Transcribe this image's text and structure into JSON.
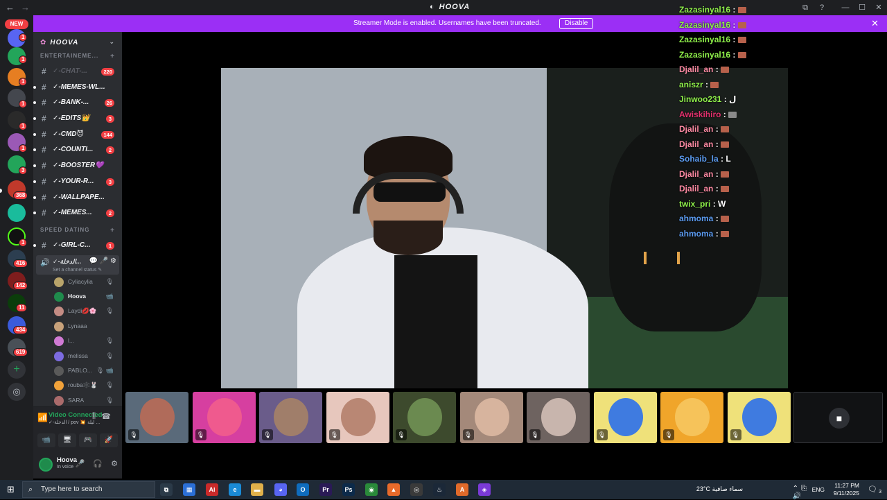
{
  "titlebar": {
    "app_name": "HOOVA",
    "back": "←",
    "forward": "→",
    "buttons": [
      "⧉",
      "?",
      "—",
      "☐",
      "✕"
    ]
  },
  "banner": {
    "message": "Streamer Mode is enabled. Usernames have been truncated.",
    "disable_label": "Disable",
    "close": "✕"
  },
  "guilds": {
    "new_label": "NEW",
    "badges": [
      "1",
      "1",
      "1",
      "1",
      "1",
      "1",
      "3",
      "1",
      "368",
      "1",
      "416",
      "142",
      "11",
      "434",
      "619"
    ]
  },
  "server": {
    "name": "HOOVA",
    "categories": [
      {
        "label": "ENTERTAINEME...",
        "plus": "+"
      },
      {
        "label": "SPEED DATING",
        "plus": "+"
      }
    ],
    "channels": [
      {
        "name": "✓-CHAT-...",
        "count": "220",
        "muted": true
      },
      {
        "name": "✓-MEMES-WL...",
        "count": ""
      },
      {
        "name": "✓-BANK-...",
        "count": "26"
      },
      {
        "name": "✓-EDITS👑",
        "count": "3"
      },
      {
        "name": "✓-CMD😈",
        "count": "144"
      },
      {
        "name": "✓-COUNTI...",
        "count": "2"
      },
      {
        "name": "✓-BOOSTER💜",
        "count": ""
      },
      {
        "name": "✓-YOUR-R...",
        "count": "3"
      },
      {
        "name": "✓-WALLPAPE...",
        "count": ""
      },
      {
        "name": "✓-MEMES...",
        "count": "2"
      }
    ],
    "speed_dating_channels": [
      {
        "name": "✓-GIRL-C...",
        "count": "1"
      }
    ],
    "voice_channel": {
      "name": "✓-الدخلة...",
      "status_hint": "Set a channel status ✎",
      "icons": "💬 🎤 ⚙"
    },
    "members": [
      {
        "name": "Cyliacylia",
        "color": "#b9a46a",
        "icon": "🎙"
      },
      {
        "name": "Hoova",
        "color": "#1f8b4c",
        "icon": "📹",
        "me": true
      },
      {
        "name": "Laydi💋🌸",
        "color": "#c48c84",
        "icon": "🎙"
      },
      {
        "name": "Lynaaa",
        "color": "#c7a17a",
        "icon": ""
      },
      {
        "name": "l...",
        "color": "#d07ad4",
        "icon": "🎙"
      },
      {
        "name": "melissa",
        "color": "#7c6be0",
        "icon": "🎙"
      },
      {
        "name": "PABLO...",
        "color": "#5a5a5a",
        "icon": "🎙 📹"
      },
      {
        "name": "rouba🕸️🐰",
        "color": "#f1a23a",
        "icon": "🎙"
      },
      {
        "name": "SARA",
        "color": "#aa6b6b",
        "icon": "🎙"
      }
    ]
  },
  "voice_panel": {
    "title": "Video Connected",
    "subtitle": "✓-الدخلة / pov 💥 ليلة ...",
    "buttons": [
      "📹",
      "🖥",
      "🎮",
      "🚀"
    ]
  },
  "user_panel": {
    "name": "Hoova",
    "status": "In voice",
    "controls": [
      "🎤",
      "🎧",
      "⚙"
    ]
  },
  "tiles": [
    {
      "bg": "#5a6a7a",
      "avatar": "#b06b5a",
      "mute": "🎙"
    },
    {
      "bg": "#d63fa0",
      "avatar": "#ef5a8e",
      "mute": "🎙"
    },
    {
      "bg": "#6a5c8a",
      "avatar": "#a07e6a",
      "mute": "🎙"
    },
    {
      "bg": "#e7c7bd",
      "avatar": "#b98774",
      "mute": "🎙"
    },
    {
      "bg": "#3d4a2d",
      "avatar": "#6b8a50",
      "mute": "🎙"
    },
    {
      "bg": "#a4897a",
      "avatar": "#d7b49e",
      "mute": "🎙"
    },
    {
      "bg": "#6e6360",
      "avatar": "#c8b5ad",
      "mute": "🎙"
    },
    {
      "bg": "#efe17a",
      "avatar": "#3f7be0",
      "mute": "🎙"
    },
    {
      "bg": "#f0a52a",
      "avatar": "#f6c35a",
      "mute": "🎙"
    },
    {
      "bg": "#efe17a",
      "avatar": "#3f7be0",
      "mute": "🎙"
    }
  ],
  "chat": [
    {
      "user": "Zazasinyal16",
      "color": "#8ff04a",
      "msg": ""
    },
    {
      "user": "Zazasinyal16",
      "color": "#8ff04a",
      "msg": ""
    },
    {
      "user": "Zazasinyal16",
      "color": "#8ff04a",
      "msg": ""
    },
    {
      "user": "Zazasinyal16",
      "color": "#8ff04a",
      "msg": ""
    },
    {
      "user": "Djalil_an",
      "color": "#ff8aa3",
      "msg": ""
    },
    {
      "user": "aniszr",
      "color": "#8ff04a",
      "msg": ""
    },
    {
      "user": "Jinwoo231",
      "color": "#8ff04a",
      "msg": "ل"
    },
    {
      "user": "Awiskihiro",
      "color": "#e0306c",
      "msg": ""
    },
    {
      "user": "Djalil_an",
      "color": "#ff8aa3",
      "msg": ""
    },
    {
      "user": "Djalil_an",
      "color": "#ff8aa3",
      "msg": ""
    },
    {
      "user": "Sohaib_la",
      "color": "#5b9bf0",
      "msg": "L"
    },
    {
      "user": "Djalil_an",
      "color": "#ff8aa3",
      "msg": ""
    },
    {
      "user": "Djalil_an",
      "color": "#ff8aa3",
      "msg": ""
    },
    {
      "user": "twix_pri",
      "color": "#8ff04a",
      "msg": "W"
    },
    {
      "user": "ahmoma",
      "color": "#5b9bf0",
      "msg": ""
    },
    {
      "user": "ahmoma",
      "color": "#5b9bf0",
      "msg": ""
    }
  ],
  "taskbar": {
    "search_placeholder": "Type here to search",
    "apps": [
      {
        "label": "⧉",
        "color": "#2b3a48"
      },
      {
        "label": "▦",
        "color": "#2b6fd6"
      },
      {
        "label": "Ai",
        "color": "#c92a2a"
      },
      {
        "label": "e",
        "color": "#1a8ad6"
      },
      {
        "label": "▬",
        "color": "#e0b04a"
      },
      {
        "label": "◕",
        "color": "#5865f2"
      },
      {
        "label": "O",
        "color": "#0f6cbd"
      },
      {
        "label": "Pr",
        "color": "#2a1a56"
      },
      {
        "label": "Ps",
        "color": "#0c2a4a"
      },
      {
        "label": "◉",
        "color": "#2a8a3a"
      },
      {
        "label": "▲",
        "color": "#e86a2a"
      },
      {
        "label": "◎",
        "color": "#3a3a3a"
      },
      {
        "label": "♨",
        "color": "#1b2838"
      },
      {
        "label": "A",
        "color": "#e06a2a"
      },
      {
        "label": "◈",
        "color": "#7a3ad6"
      }
    ],
    "weather": "23°C  سماء صافية",
    "lang": "ENG",
    "time": "11:27 PM",
    "date": "9/11/2025",
    "notif_count": "3"
  }
}
